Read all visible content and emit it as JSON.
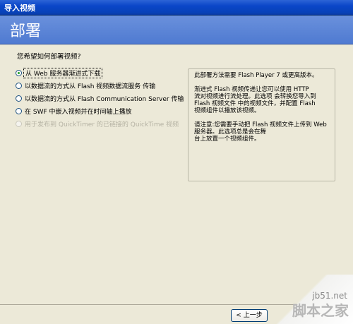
{
  "window": {
    "title": "导入视频"
  },
  "header": {
    "title": "部署"
  },
  "question": "您希望如何部署视频?",
  "options": [
    {
      "label": "从 Web 服务器渐进式下载",
      "checked": true,
      "disabled": false
    },
    {
      "label": "以数据流的方式从 Flash 视频数据流服务 传输",
      "checked": false,
      "disabled": false
    },
    {
      "label": "以数据流的方式从 Flash Communication Server 传输",
      "checked": false,
      "disabled": false
    },
    {
      "label": "在 SWF 中嵌入视频并在时间轴上播放",
      "checked": false,
      "disabled": false
    },
    {
      "label": "用于发布到 QuickTimer 的已链接的 QuickTime 视频",
      "checked": false,
      "disabled": true
    }
  ],
  "info": {
    "p1": "此部署方法需要 Flash Player 7 或更高版本。",
    "p2": "渐进式 Flash 视频传递让您可以使用 HTTP\n流对视频进行流处理。此选项 会转换您导入到\nFlash 视频文件 中的视频文件，并配置 Flash\n视频组件以播放该视频。",
    "p3": "请注意:您需要手动把 Flash 视频文件上传到 Web\n服务器。此选项总是会在舞\n台上放置一个视频组件。"
  },
  "footer": {
    "back_label": "< 上一步"
  },
  "watermark": {
    "site": "jb51.net",
    "name": "脚本之家"
  }
}
